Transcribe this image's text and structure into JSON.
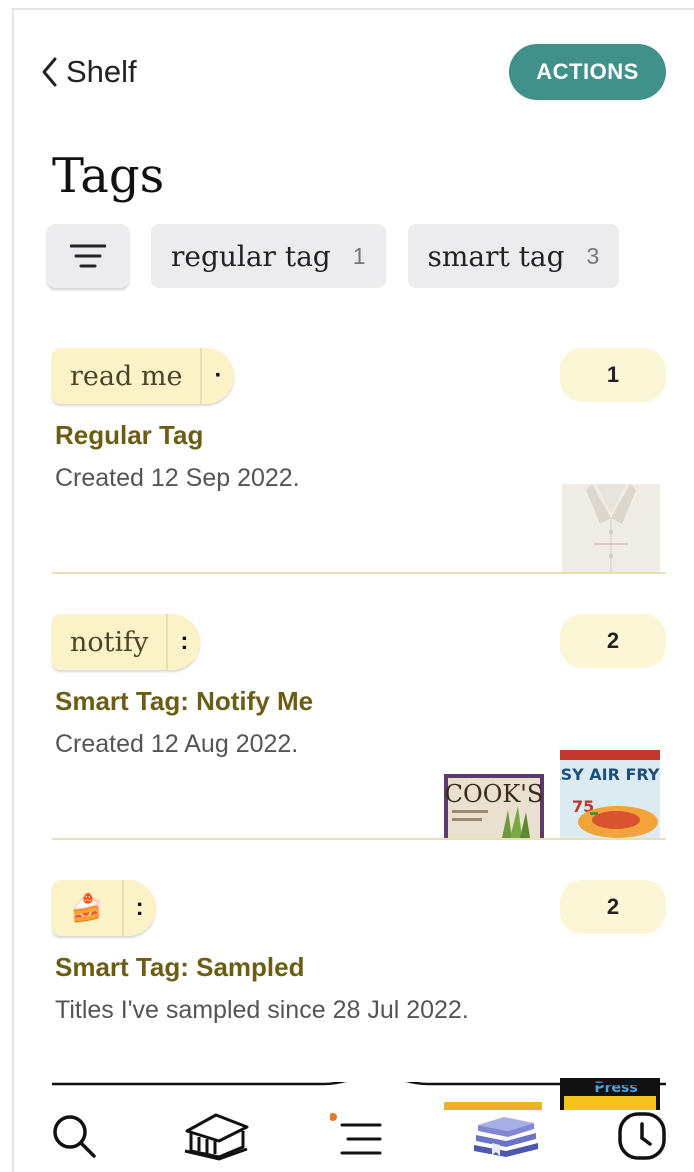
{
  "header": {
    "back_label": "Shelf",
    "actions_label": "ACTIONS",
    "page_title": "Tags"
  },
  "filters": {
    "chips": [
      {
        "label": "regular tag",
        "count": "1"
      },
      {
        "label": "smart tag",
        "count": "3"
      }
    ]
  },
  "tags": [
    {
      "pill": "read me",
      "count": "1",
      "name": "Regular Tag",
      "description": "Created 12 Sep 2022."
    },
    {
      "pill": "notify",
      "count": "2",
      "name": "Smart Tag: Notify Me",
      "description": "Created 12 Aug 2022."
    },
    {
      "pill": "🍰",
      "count": "2",
      "name": "Smart Tag: Sampled",
      "description": "Titles I've sampled since 28 Jul 2022."
    }
  ],
  "covers": {
    "cooks_title": "COOK'S",
    "air_fryer_title": "EASY AIR FRYER",
    "air_fryer_number": "75",
    "press_start": "Press"
  },
  "bottom_nav": [
    "search-icon",
    "library-icon",
    "menu-icon",
    "shelf-books-icon",
    "clock-icon"
  ],
  "colors": {
    "accent_teal": "#3f918a",
    "tag_name_olive": "#6b5e14",
    "pill_yellow": "#fbf2c8",
    "shelf_blue": "#4d57b0"
  }
}
